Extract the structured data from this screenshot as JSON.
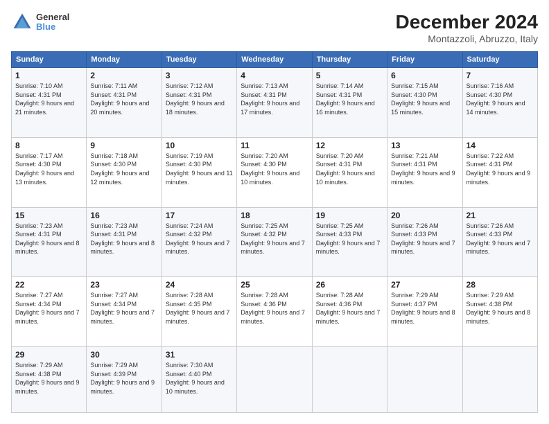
{
  "logo": {
    "line1": "General",
    "line2": "Blue"
  },
  "header": {
    "title": "December 2024",
    "subtitle": "Montazzoli, Abruzzo, Italy"
  },
  "weekdays": [
    "Sunday",
    "Monday",
    "Tuesday",
    "Wednesday",
    "Thursday",
    "Friday",
    "Saturday"
  ],
  "weeks": [
    [
      {
        "day": "1",
        "sunrise": "Sunrise: 7:10 AM",
        "sunset": "Sunset: 4:31 PM",
        "daylight": "Daylight: 9 hours and 21 minutes."
      },
      {
        "day": "2",
        "sunrise": "Sunrise: 7:11 AM",
        "sunset": "Sunset: 4:31 PM",
        "daylight": "Daylight: 9 hours and 20 minutes."
      },
      {
        "day": "3",
        "sunrise": "Sunrise: 7:12 AM",
        "sunset": "Sunset: 4:31 PM",
        "daylight": "Daylight: 9 hours and 18 minutes."
      },
      {
        "day": "4",
        "sunrise": "Sunrise: 7:13 AM",
        "sunset": "Sunset: 4:31 PM",
        "daylight": "Daylight: 9 hours and 17 minutes."
      },
      {
        "day": "5",
        "sunrise": "Sunrise: 7:14 AM",
        "sunset": "Sunset: 4:31 PM",
        "daylight": "Daylight: 9 hours and 16 minutes."
      },
      {
        "day": "6",
        "sunrise": "Sunrise: 7:15 AM",
        "sunset": "Sunset: 4:30 PM",
        "daylight": "Daylight: 9 hours and 15 minutes."
      },
      {
        "day": "7",
        "sunrise": "Sunrise: 7:16 AM",
        "sunset": "Sunset: 4:30 PM",
        "daylight": "Daylight: 9 hours and 14 minutes."
      }
    ],
    [
      {
        "day": "8",
        "sunrise": "Sunrise: 7:17 AM",
        "sunset": "Sunset: 4:30 PM",
        "daylight": "Daylight: 9 hours and 13 minutes."
      },
      {
        "day": "9",
        "sunrise": "Sunrise: 7:18 AM",
        "sunset": "Sunset: 4:30 PM",
        "daylight": "Daylight: 9 hours and 12 minutes."
      },
      {
        "day": "10",
        "sunrise": "Sunrise: 7:19 AM",
        "sunset": "Sunset: 4:30 PM",
        "daylight": "Daylight: 9 hours and 11 minutes."
      },
      {
        "day": "11",
        "sunrise": "Sunrise: 7:20 AM",
        "sunset": "Sunset: 4:30 PM",
        "daylight": "Daylight: 9 hours and 10 minutes."
      },
      {
        "day": "12",
        "sunrise": "Sunrise: 7:20 AM",
        "sunset": "Sunset: 4:31 PM",
        "daylight": "Daylight: 9 hours and 10 minutes."
      },
      {
        "day": "13",
        "sunrise": "Sunrise: 7:21 AM",
        "sunset": "Sunset: 4:31 PM",
        "daylight": "Daylight: 9 hours and 9 minutes."
      },
      {
        "day": "14",
        "sunrise": "Sunrise: 7:22 AM",
        "sunset": "Sunset: 4:31 PM",
        "daylight": "Daylight: 9 hours and 9 minutes."
      }
    ],
    [
      {
        "day": "15",
        "sunrise": "Sunrise: 7:23 AM",
        "sunset": "Sunset: 4:31 PM",
        "daylight": "Daylight: 9 hours and 8 minutes."
      },
      {
        "day": "16",
        "sunrise": "Sunrise: 7:23 AM",
        "sunset": "Sunset: 4:31 PM",
        "daylight": "Daylight: 9 hours and 8 minutes."
      },
      {
        "day": "17",
        "sunrise": "Sunrise: 7:24 AM",
        "sunset": "Sunset: 4:32 PM",
        "daylight": "Daylight: 9 hours and 7 minutes."
      },
      {
        "day": "18",
        "sunrise": "Sunrise: 7:25 AM",
        "sunset": "Sunset: 4:32 PM",
        "daylight": "Daylight: 9 hours and 7 minutes."
      },
      {
        "day": "19",
        "sunrise": "Sunrise: 7:25 AM",
        "sunset": "Sunset: 4:33 PM",
        "daylight": "Daylight: 9 hours and 7 minutes."
      },
      {
        "day": "20",
        "sunrise": "Sunrise: 7:26 AM",
        "sunset": "Sunset: 4:33 PM",
        "daylight": "Daylight: 9 hours and 7 minutes."
      },
      {
        "day": "21",
        "sunrise": "Sunrise: 7:26 AM",
        "sunset": "Sunset: 4:33 PM",
        "daylight": "Daylight: 9 hours and 7 minutes."
      }
    ],
    [
      {
        "day": "22",
        "sunrise": "Sunrise: 7:27 AM",
        "sunset": "Sunset: 4:34 PM",
        "daylight": "Daylight: 9 hours and 7 minutes."
      },
      {
        "day": "23",
        "sunrise": "Sunrise: 7:27 AM",
        "sunset": "Sunset: 4:34 PM",
        "daylight": "Daylight: 9 hours and 7 minutes."
      },
      {
        "day": "24",
        "sunrise": "Sunrise: 7:28 AM",
        "sunset": "Sunset: 4:35 PM",
        "daylight": "Daylight: 9 hours and 7 minutes."
      },
      {
        "day": "25",
        "sunrise": "Sunrise: 7:28 AM",
        "sunset": "Sunset: 4:36 PM",
        "daylight": "Daylight: 9 hours and 7 minutes."
      },
      {
        "day": "26",
        "sunrise": "Sunrise: 7:28 AM",
        "sunset": "Sunset: 4:36 PM",
        "daylight": "Daylight: 9 hours and 7 minutes."
      },
      {
        "day": "27",
        "sunrise": "Sunrise: 7:29 AM",
        "sunset": "Sunset: 4:37 PM",
        "daylight": "Daylight: 9 hours and 8 minutes."
      },
      {
        "day": "28",
        "sunrise": "Sunrise: 7:29 AM",
        "sunset": "Sunset: 4:38 PM",
        "daylight": "Daylight: 9 hours and 8 minutes."
      }
    ],
    [
      {
        "day": "29",
        "sunrise": "Sunrise: 7:29 AM",
        "sunset": "Sunset: 4:38 PM",
        "daylight": "Daylight: 9 hours and 9 minutes."
      },
      {
        "day": "30",
        "sunrise": "Sunrise: 7:29 AM",
        "sunset": "Sunset: 4:39 PM",
        "daylight": "Daylight: 9 hours and 9 minutes."
      },
      {
        "day": "31",
        "sunrise": "Sunrise: 7:30 AM",
        "sunset": "Sunset: 4:40 PM",
        "daylight": "Daylight: 9 hours and 10 minutes."
      },
      {
        "day": "",
        "sunrise": "",
        "sunset": "",
        "daylight": ""
      },
      {
        "day": "",
        "sunrise": "",
        "sunset": "",
        "daylight": ""
      },
      {
        "day": "",
        "sunrise": "",
        "sunset": "",
        "daylight": ""
      },
      {
        "day": "",
        "sunrise": "",
        "sunset": "",
        "daylight": ""
      }
    ]
  ]
}
